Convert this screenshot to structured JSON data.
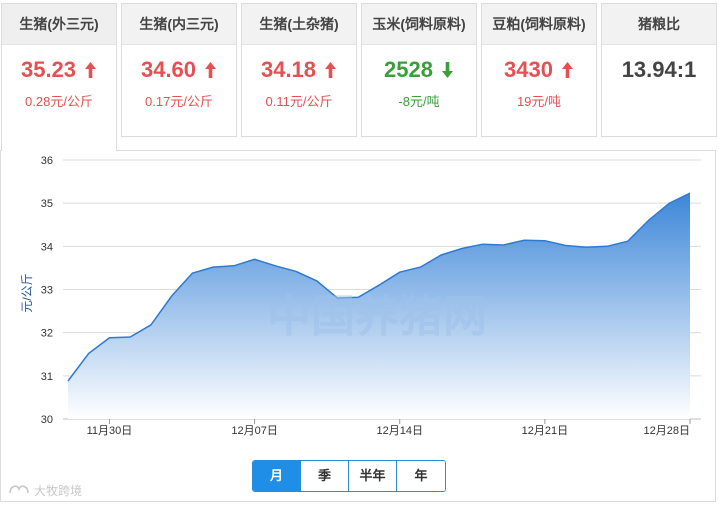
{
  "cards": [
    {
      "title": "生猪(外三元)",
      "value": "35.23",
      "change": "0.28元/公斤",
      "trend": "up"
    },
    {
      "title": "生猪(内三元)",
      "value": "34.60",
      "change": "0.17元/公斤",
      "trend": "up"
    },
    {
      "title": "生猪(土杂猪)",
      "value": "34.18",
      "change": "0.11元/公斤",
      "trend": "up"
    },
    {
      "title": "玉米(饲料原料)",
      "value": "2528",
      "change": "-8元/吨",
      "trend": "down"
    },
    {
      "title": "豆粕(饲料原料)",
      "value": "3430",
      "change": "19元/吨",
      "trend": "up"
    },
    {
      "title": "猪粮比",
      "value": "13.94:1",
      "change": "",
      "trend": "none"
    }
  ],
  "colors": {
    "up": "#e65053",
    "down": "#3a9f3a",
    "accent": "#1f8ee6",
    "area_top": "#3d86d8",
    "area_bottom": "#ffffff"
  },
  "watermark": "中国养猪网",
  "range_tabs": [
    "月",
    "季",
    "半年",
    "年"
  ],
  "selected_range": "月",
  "brand": "大牧跨境",
  "chart_data": {
    "type": "area",
    "ylabel": "元/公斤",
    "ylim": [
      30,
      36
    ],
    "yticks": [
      30,
      31,
      32,
      33,
      34,
      35,
      36
    ],
    "grid": true,
    "xtick_labels": [
      {
        "label": "11月30日",
        "x": "2020-11-30"
      },
      {
        "label": "12月07日",
        "x": "2020-12-07"
      },
      {
        "label": "12月14日",
        "x": "2020-12-14"
      },
      {
        "label": "12月21日",
        "x": "2020-12-21"
      },
      {
        "label": "12月28日",
        "x": "2020-12-28"
      }
    ],
    "x": [
      "2020-11-28",
      "2020-11-29",
      "2020-11-30",
      "2020-12-01",
      "2020-12-02",
      "2020-12-03",
      "2020-12-04",
      "2020-12-05",
      "2020-12-06",
      "2020-12-07",
      "2020-12-08",
      "2020-12-09",
      "2020-12-10",
      "2020-12-11",
      "2020-12-12",
      "2020-12-13",
      "2020-12-14",
      "2020-12-15",
      "2020-12-16",
      "2020-12-17",
      "2020-12-18",
      "2020-12-19",
      "2020-12-20",
      "2020-12-21",
      "2020-12-22",
      "2020-12-23",
      "2020-12-24",
      "2020-12-25",
      "2020-12-26",
      "2020-12-27",
      "2020-12-28"
    ],
    "y": [
      30.88,
      31.52,
      31.88,
      31.9,
      32.18,
      32.85,
      33.38,
      33.52,
      33.55,
      33.7,
      33.55,
      33.42,
      33.2,
      32.8,
      32.82,
      33.1,
      33.4,
      33.52,
      33.8,
      33.95,
      34.05,
      34.03,
      34.14,
      34.13,
      34.02,
      33.98,
      34.0,
      34.12,
      34.6,
      35.0,
      35.23
    ]
  }
}
